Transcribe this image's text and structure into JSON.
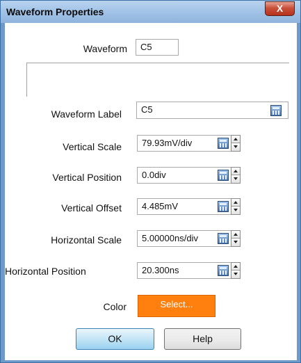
{
  "window": {
    "title": "Waveform Properties",
    "close_label": "X"
  },
  "waveform": {
    "label": "Waveform",
    "value": "C5"
  },
  "fields": {
    "waveform_label": {
      "label": "Waveform Label",
      "value": "C5"
    },
    "vertical_scale": {
      "label": "Vertical Scale",
      "value": "79.93mV/div"
    },
    "vertical_position": {
      "label": "Vertical Position",
      "value": "0.0div"
    },
    "vertical_offset": {
      "label": "Vertical Offset",
      "value": "4.485mV"
    },
    "horizontal_scale": {
      "label": "Horizontal Scale",
      "value": "5.00000ns/div"
    },
    "horizontal_position": {
      "label": "Horizontal Position",
      "value": "20.300ns"
    }
  },
  "color": {
    "label": "Color",
    "button_label": "Select...",
    "swatch": "#ff7f0f"
  },
  "buttons": {
    "ok": "OK",
    "help": "Help"
  },
  "icons": {
    "calculator": "calculator-icon",
    "spin_up": "spin-up-arrow-icon",
    "spin_down": "spin-down-arrow-icon",
    "close": "close-icon"
  }
}
